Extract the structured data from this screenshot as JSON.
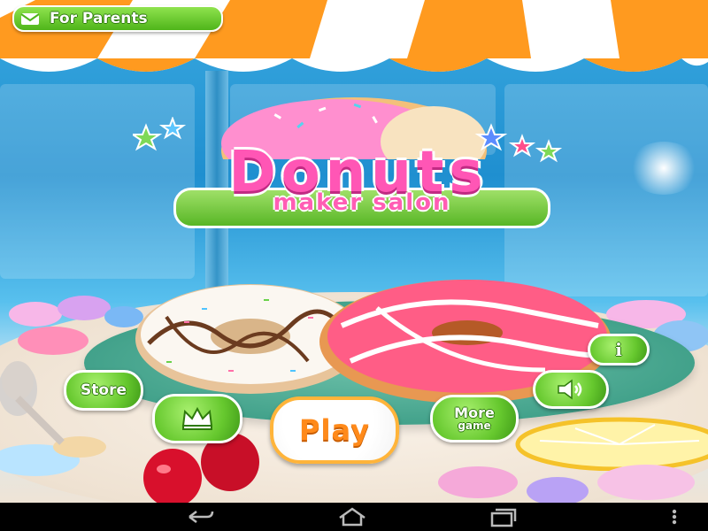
{
  "parents_button": {
    "label": "For Parents",
    "icon": "envelope-icon"
  },
  "logo": {
    "title": "Donuts",
    "subtitle": "maker salon"
  },
  "menu": {
    "store_label": "Store",
    "crown_icon": "crown-icon",
    "play_label": "Play",
    "more_label_line1": "More",
    "more_label_line2": "game",
    "info_label": "i",
    "sound_icon": "speaker-icon"
  },
  "navbar": {
    "back_icon": "back-arrow-icon",
    "home_icon": "home-icon",
    "recents_icon": "recent-apps-icon",
    "overflow_icon": "more-vert-icon"
  },
  "colors": {
    "accent_green": "#66c82e",
    "play_orange": "#ff8a1a",
    "logo_pink": "#ff56b5",
    "awning_orange": "#ff9a1f"
  }
}
